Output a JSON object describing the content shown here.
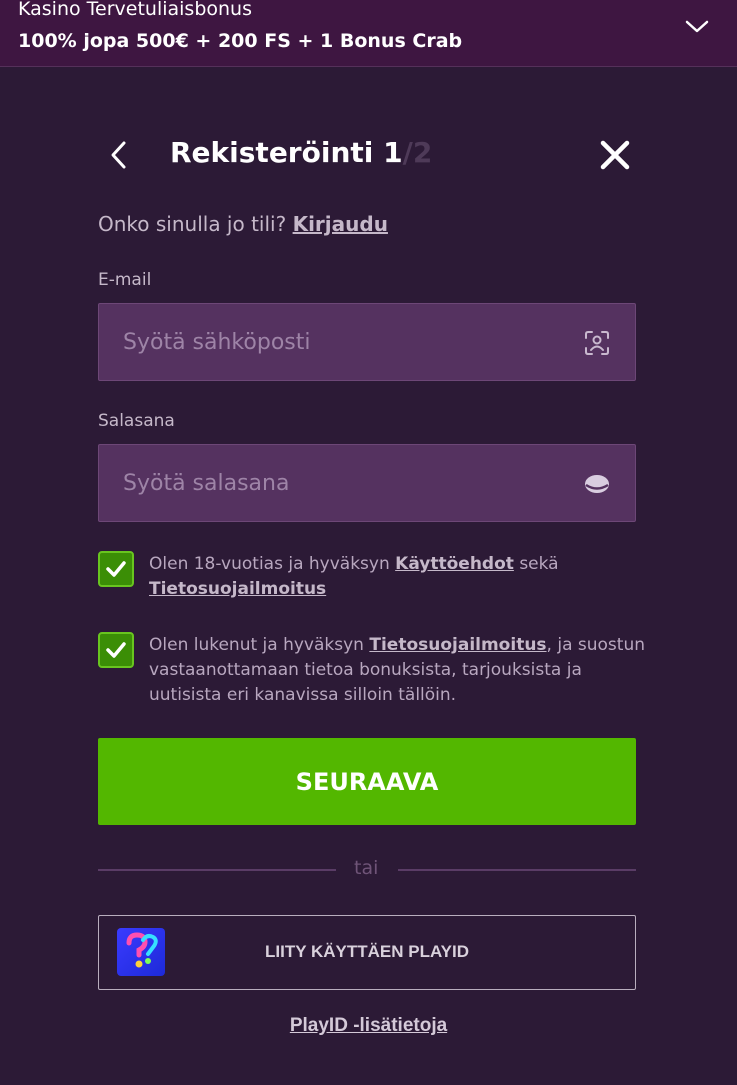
{
  "bonus_banner": {
    "title": "Kasino Tervetuliaisbonus",
    "offer": "100% jopa 500€ + 200 FS + 1 Bonus Crab"
  },
  "header": {
    "title": "Rekisteröinti",
    "step_current": "1",
    "step_total": "/2"
  },
  "login_prompt": {
    "text": "Onko sinulla jo tili?",
    "link": "Kirjaudu"
  },
  "email_field": {
    "label": "E-mail",
    "placeholder": "Syötä sähköposti",
    "value": ""
  },
  "password_field": {
    "label": "Salasana",
    "placeholder": "Syötä salasana",
    "value": ""
  },
  "consents": [
    {
      "checked": true,
      "text_before": "Olen 18-vuotias ja hyväksyn",
      "link1": "Käyttöehdot",
      "text_middle": "sekä",
      "link2": "Tietosuojailmoitus"
    },
    {
      "checked": true,
      "text_before": "Olen lukenut ja hyväksyn",
      "link": "Tietosuojailmoitus",
      "text_after": ", ja suostun vastaanottamaan tietoa bonuksista, tarjouksista ja uutisista eri kanavissa silloin tällöin."
    }
  ],
  "next_button": "SEURAAVA",
  "divider_text": "tai",
  "playid": {
    "button_label": "LIITY KÄYTTÄEN PLAYID",
    "info_link": "PlayID -lisätietoja"
  },
  "icons": {
    "bonus_toggle": "chevron-down-icon",
    "back": "chevron-left-icon",
    "close": "close-icon",
    "email": "face-scan-icon",
    "password": "eye-icon",
    "checkbox": "checkmark-icon",
    "playid": "playid-logo-icon"
  },
  "colors": {
    "background": "#2c1a36",
    "banner": "#3e1641",
    "input_background": "#553260",
    "checkbox_green": "#3b8e06",
    "primary_button": "#53b700",
    "text_muted": "#c5b8c9"
  }
}
